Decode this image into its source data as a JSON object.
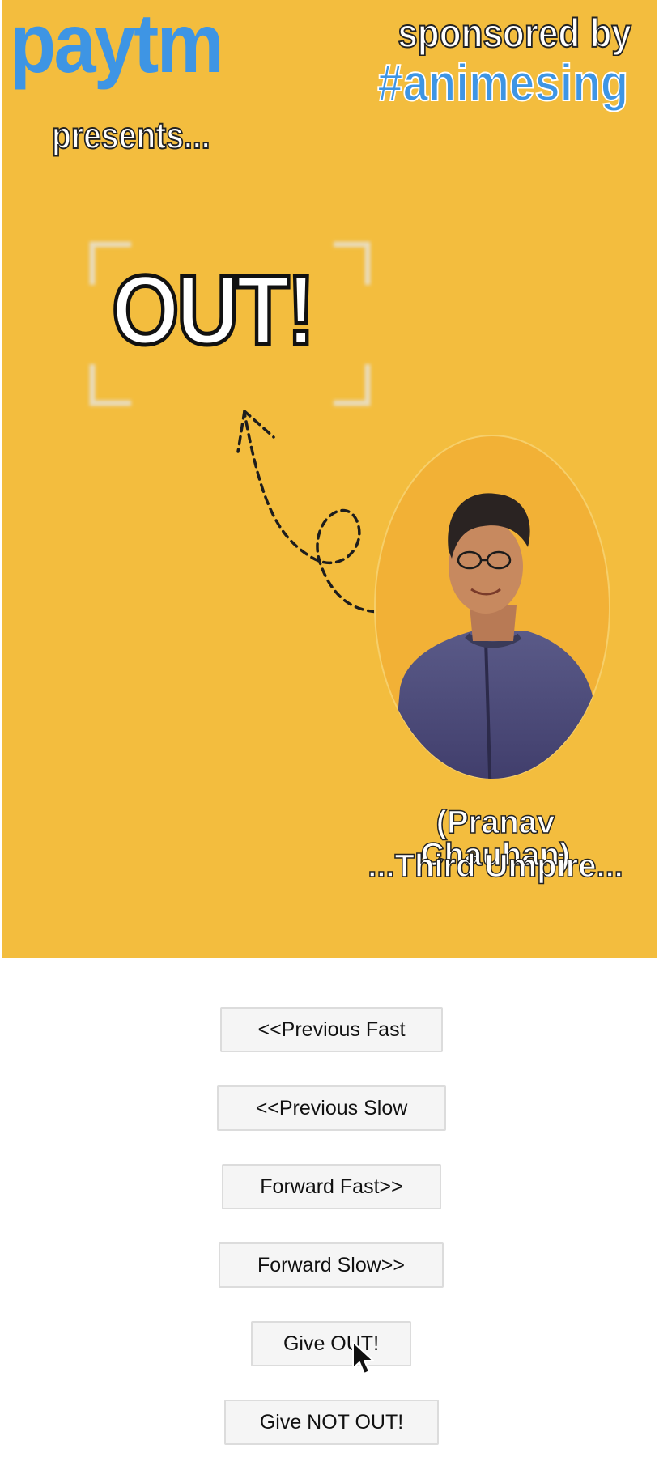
{
  "banner": {
    "brand": "paytm",
    "presents": "presents...",
    "sponsored": "sponsored by",
    "hashtag": "#animesing",
    "title": "OUT!",
    "person_name": "(Pranav Chauhan)",
    "person_role": "...Third Umpire..."
  },
  "colors": {
    "banner_bg": "#f3bd3e",
    "brand_blue": "#3e95e4",
    "portrait_bg": "#f2b136"
  },
  "controls": {
    "prev_fast": "<<Previous Fast",
    "prev_slow": "<<Previous Slow",
    "forward_fast": "Forward Fast>>",
    "forward_slow": "Forward Slow>>",
    "give_out": "Give OUT!",
    "give_not_out": "Give NOT OUT!"
  },
  "icons": {
    "cursor": "mouse-pointer-icon",
    "arrow": "dashed-arrow-icon",
    "frame": "focus-frame-icon"
  }
}
